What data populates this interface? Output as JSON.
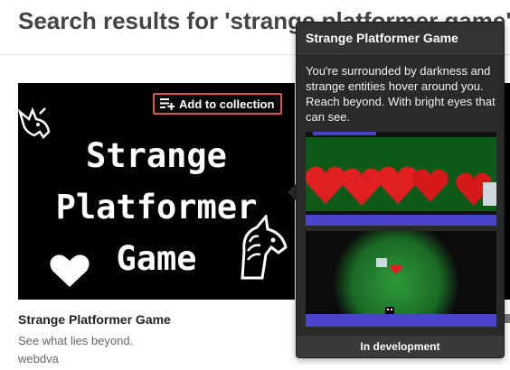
{
  "page": {
    "title": "Search results for 'strange platformer game'"
  },
  "result": {
    "thumbnail_title_lines": [
      "Strange",
      "Platformer",
      "Game"
    ],
    "collection_button_label": "Add to collection",
    "title": "Strange Platformer Game",
    "description": "See what lies beyond.",
    "author": "webdva"
  },
  "popup": {
    "title": "Strange Platformer Game",
    "description": "You're surrounded by darkness and strange entities hover around you. Reach beyond. With bright eyes that can see.",
    "status": "In development"
  },
  "colors": {
    "collection_button_border": "#e0514f",
    "popup_background": "#2a2a2a",
    "heading": "#444444"
  },
  "icons": [
    "playlist-add-icon",
    "unicorn-icon",
    "heart-icon"
  ]
}
